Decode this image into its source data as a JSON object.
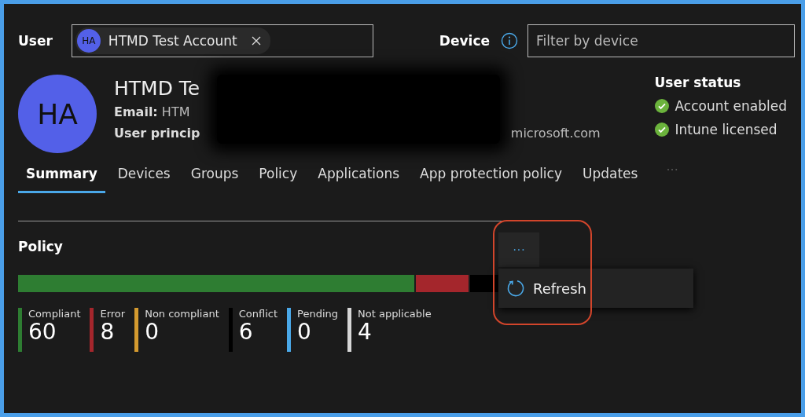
{
  "filters": {
    "user_label": "User",
    "user_chip": {
      "initials": "HA",
      "name": "HTMD Test Account"
    },
    "device_label": "Device",
    "device_placeholder": "Filter by device"
  },
  "profile": {
    "initials": "HA",
    "name": "HTMD Te",
    "email_label": "Email:",
    "email_value": "HTM",
    "upn_start": "User princip",
    "upn_end": "microsoft.com"
  },
  "user_status": {
    "title": "User status",
    "items": [
      {
        "label": "Account enabled",
        "ok": true
      },
      {
        "label": "Intune licensed",
        "ok": true
      }
    ]
  },
  "tabs": [
    {
      "label": "Summary",
      "selected": true
    },
    {
      "label": "Devices",
      "selected": false
    },
    {
      "label": "Groups",
      "selected": false
    },
    {
      "label": "Policy",
      "selected": false
    },
    {
      "label": "Applications",
      "selected": false
    },
    {
      "label": "App protection policy",
      "selected": false
    },
    {
      "label": "Updates",
      "selected": false
    }
  ],
  "tabs_overflow": "···",
  "policy": {
    "title": "Policy",
    "more_menu": {
      "label": "···",
      "highlighted": true,
      "items": [
        {
          "label": "Refresh"
        }
      ]
    },
    "legend": [
      {
        "label": "Compliant",
        "count": "60",
        "color": "#2e7d32"
      },
      {
        "label": "Error",
        "count": "8",
        "color": "#a4262c"
      },
      {
        "label": "Non compliant",
        "count": "0",
        "color": "#d49a2f"
      },
      {
        "label": "Conflict",
        "count": "6",
        "color": "#000000"
      },
      {
        "label": "Pending",
        "count": "0",
        "color": "#4aa8e8"
      },
      {
        "label": "Not applicable",
        "count": "4",
        "color": "#d6d6d6"
      }
    ]
  }
}
